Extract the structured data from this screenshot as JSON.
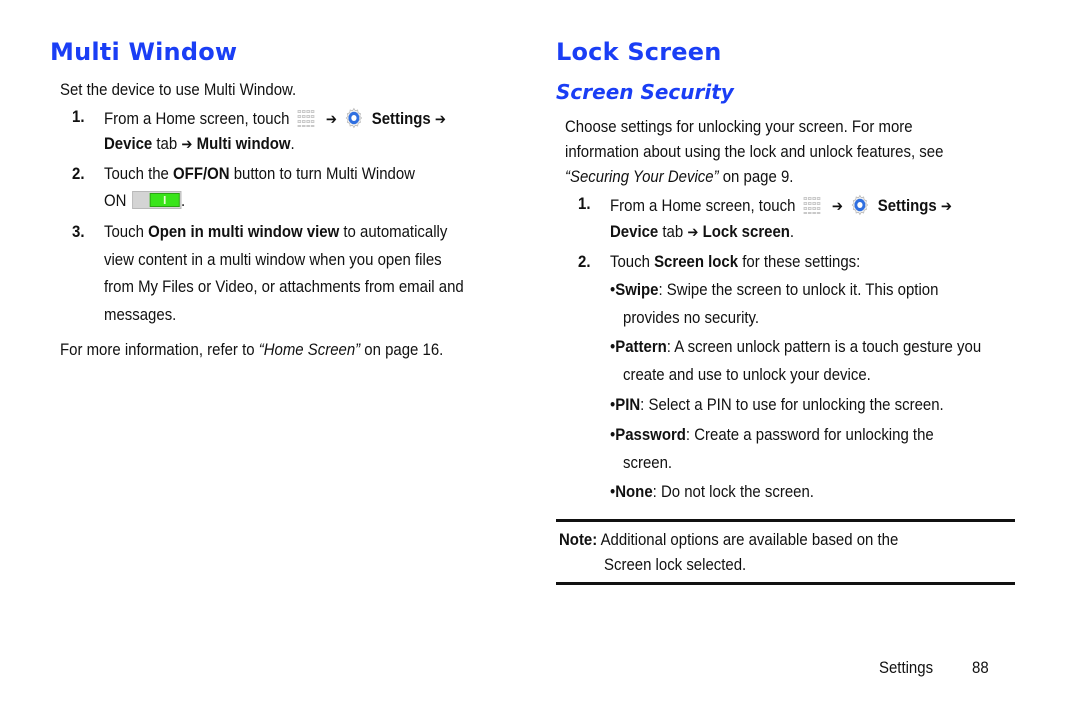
{
  "left": {
    "title": "Multi Window",
    "intro": "Set the device to use Multi Window.",
    "step1": {
      "num": "1.",
      "pre": "From a Home screen, touch",
      "settings": "Settings",
      "device": "Device",
      "tab": " tab ",
      "target": "Multi window",
      "end": "."
    },
    "step2": {
      "num": "2.",
      "pre": "Touch the ",
      "bold": "OFF/ON",
      "post": " button to turn Multi Window",
      "on_label": "ON",
      "toggle_state": "on",
      "end": "."
    },
    "step3": {
      "num": "3.",
      "pre": "Touch ",
      "bold": "Open in multi window view",
      "line1_post": " to automatically",
      "line2": "view content in a multi window when you open files",
      "line3": "from My Files or Video, or attachments from email and",
      "line4": "messages."
    },
    "more": {
      "pre": "For more information, refer to ",
      "ref": "“Home Screen”",
      "post": " on page 16."
    }
  },
  "right": {
    "title": "Lock Screen",
    "subtitle": "Screen Security",
    "intro_line1": "Choose settings for unlocking your screen. For more",
    "intro_line2": "information about using the lock and unlock features, see",
    "intro_ref": "“Securing Your Device”",
    "intro_post": " on page 9.",
    "step1": {
      "num": "1.",
      "pre": "From a Home screen, touch",
      "settings": "Settings",
      "device": "Device",
      "tab": " tab ",
      "target": "Lock screen",
      "end": "."
    },
    "step2": {
      "num": "2.",
      "pre": "Touch ",
      "bold": "Screen lock",
      "post": " for these settings:"
    },
    "bullets": [
      {
        "term": "Swipe",
        "line1": ": Swipe the screen to unlock it. This option",
        "line2": "provides no security."
      },
      {
        "term": "Pattern",
        "line1": ": A screen unlock pattern is a touch gesture you",
        "line2": "create and use to unlock your device."
      },
      {
        "term": "PIN",
        "line1": ": Select a PIN to use for unlocking the screen.",
        "line2": ""
      },
      {
        "term": "Password",
        "line1": ": Create a password for unlocking the",
        "line2": "screen."
      },
      {
        "term": "None",
        "line1": ": Do not lock the screen.",
        "line2": ""
      }
    ],
    "note": {
      "label": "Note:",
      "line1": " Additional options are available based on the",
      "line2": "Screen lock selected."
    }
  },
  "footer": {
    "section": "Settings",
    "page": "88"
  },
  "icons": {
    "arrow": "➔",
    "bullet": "•"
  },
  "colors": {
    "heading": "#1a3ef5",
    "gear": "#2f6fe0",
    "toggle_on": "#39e41a"
  }
}
